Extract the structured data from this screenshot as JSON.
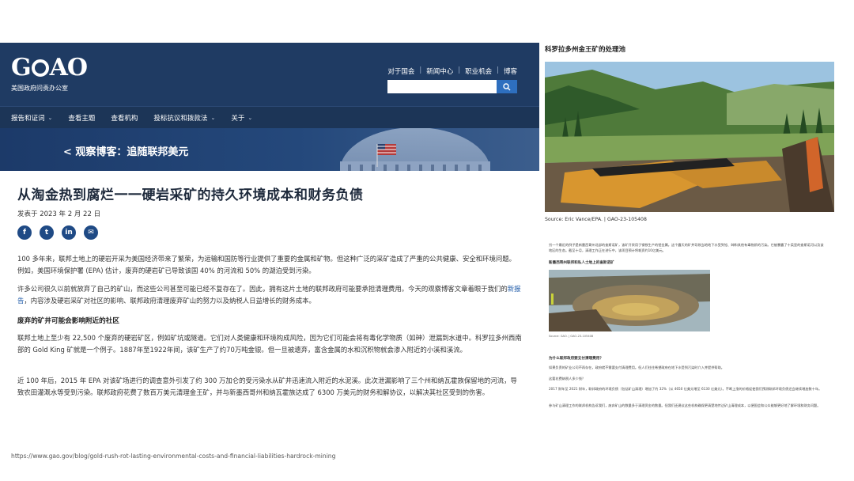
{
  "gao": {
    "logo_text": "GAO",
    "subtitle": "美国政府问责办公室",
    "top_links": [
      "对于国会",
      "新闻中心",
      "职业机会",
      "博客"
    ],
    "search_placeholder": "",
    "nav": [
      "报告和证词",
      "查看主题",
      "查看机构",
      "投标抗议和拨款法",
      "关于"
    ],
    "banner_title": "< 观察博客：追随联邦美元",
    "article_title": "从淘金热到腐烂一一硬岩采矿的持久环境成本和财务负债",
    "date": "发表于 2023 年 2 月 22 日",
    "social": [
      "f",
      "t",
      "in",
      "✉"
    ],
    "p1": "100 多年来，联邦土地上的硬岩开采为美国经济带来了繁荣，为运输和国防等行业提供了重要的金属和矿物。但这种广泛的采矿造成了严重的公共健康、安全和环境问题。例如，美国环境保护署 (EPA) 估计，废弃的硬岩矿已导致该国 40% 的河流和 50% 的湖泊受到污染。",
    "p2_a": "许多公司很久以前就放弃了自己的矿山，而这些公司甚至可能已经不复存在了。因此，拥有这片土地的联邦政府可能要承担清理费用。今天的观察博客文章着眼于我们的",
    "p2_link": "新报告",
    "p2_b": "，内容涉及硬岩采矿对社区的影响、联邦政府清理废弃矿山的努力以及纳税人日益增长的财务成本。",
    "subhead1": "废弃的矿井可能会影响附近的社区",
    "p3": "联邦土地上至少有 22,500 个废弃的硬岩矿区，例如矿坑或隧道。它们对人类健康和环境构成风险，因为它们可能会将有毒化学物质（如砷）泄漏到水道中。科罗拉多州西南部的 Gold King 矿就是一个例子。1887年至1922年间，该矿生产了约70万吨金银。但一旦被遗弃，富含金属的水和沉积物就会渗入附近的小溪和溪流。",
    "p4": "近 100 年后，2015 年 EPA 对该矿场进行的调查意外引发了约 300 万加仑的受污染水从矿井迅速流入附近的水泥溪。此次泄漏影响了三个州和纳瓦霍族保留地的河流，导致农田灌溉水等受到污染。联邦政府花费了数百万美元清理金王矿，并与新墨西哥州和纳瓦霍族达成了 6300 万美元的财务和解协议，以解决其社区受到的伤害。"
  },
  "url": "https://www.gao.gov/blog/gold-rush-rot-lasting-environmental-costs-and-financial-liabilities-hardrock-mining",
  "figure": {
    "title": "科罗拉多州金王矿的处理池",
    "source": "Source: Eric Vance/EPA.  |  GAO-23-105408",
    "small_p1": "另一个最近的例子是新墨西哥州北部的查斯诺矿，该矿开采用于钢铁生产的钼金属。这个露天的矿井导致当地地下水受到铅、砷和其他有毒物质的污染。它被暴露了十英里的查斯诺河以及该地区的生态。截至十月，清理工作正在进行中，该项目预计将耗资约10亿美元。",
    "small_title1": "新墨西哥州联邦和私人土地上的查斯诺矿",
    "small_src": "Source: GAO.  |  GAO-23-105408",
    "small_title2": "为什么联邦政府要支付清理费用？",
    "small_p2": "如果负责的矿业公司不再存在，政府就不需要支付清理费用。但人们往往希望政府在地下水受到污染时介入并提供帮助。",
    "small_p3": "这要花费纳税人多少钱？",
    "small_p4": "2017 财年至 2021 财年，联邦政府的环境负债（包括矿山清理）增加了约 32%（从 4650 亿美元增至 6130 亿美元）。不断上涨的价格促使我们预测联邦环境负债还会继续增加数十年。",
    "small_p5": "参与矿山清理工作的联邦机构告诉我们，废弃矿山的数量多于清理资金的数量。但我们还建议这些机构确保更清楚地传达矿山清理成本，以便国会和公众能够更好地了解环境和财务问题。"
  },
  "colors": {
    "header": "#1f3b63",
    "nav": "#1c3557",
    "social": "#1f4a85",
    "search_btn": "#2e6fbf"
  },
  "icons": [
    "search-icon",
    "facebook-icon",
    "twitter-icon",
    "linkedin-icon",
    "email-icon"
  ]
}
